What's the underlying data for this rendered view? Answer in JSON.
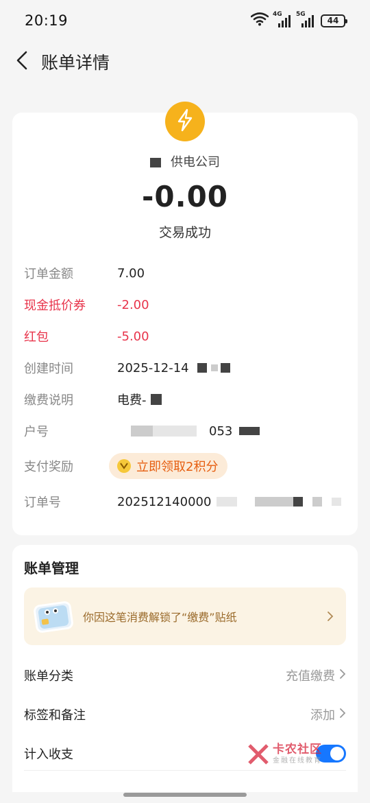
{
  "status_bar": {
    "time": "20:19",
    "signal1_label": "4G",
    "signal2_label": "5G",
    "battery": "44"
  },
  "header": {
    "title": "账单详情",
    "back_icon": "chevron-left-icon"
  },
  "summary": {
    "merchant_logo_icon": "lightning-icon",
    "merchant_logo_color": "#f6b21c",
    "merchant_name": "供电公司",
    "amount": "-0.00",
    "status": "交易成功"
  },
  "details": {
    "order_amount_label": "订单金额",
    "order_amount_value": "7.00",
    "coupon_label": "现金抵价券",
    "coupon_value": "-2.00",
    "redpacket_label": "红包",
    "redpacket_value": "-5.00",
    "created_label": "创建时间",
    "created_value": "2025-12-14",
    "description_label": "缴费说明",
    "description_value": "电费-",
    "account_label": "户号",
    "account_value": "053",
    "reward_label": "支付奖励",
    "reward_button": "立即领取2积分",
    "order_no_label": "订单号",
    "order_no_value": "202512140000"
  },
  "management": {
    "title": "账单管理",
    "sticker_text": "你因这笔消费解锁了“缴费”贴纸",
    "category_label": "账单分类",
    "category_value": "充值缴费",
    "tags_label": "标签和备注",
    "tags_value": "添加",
    "include_label": "计入收支",
    "include_enabled": true
  },
  "watermark": {
    "title": "卡农社区",
    "subtitle": "金融在线教育"
  },
  "colors": {
    "accent": "#1677ff",
    "negative": "#e8344b",
    "reward": "#e65e10"
  }
}
